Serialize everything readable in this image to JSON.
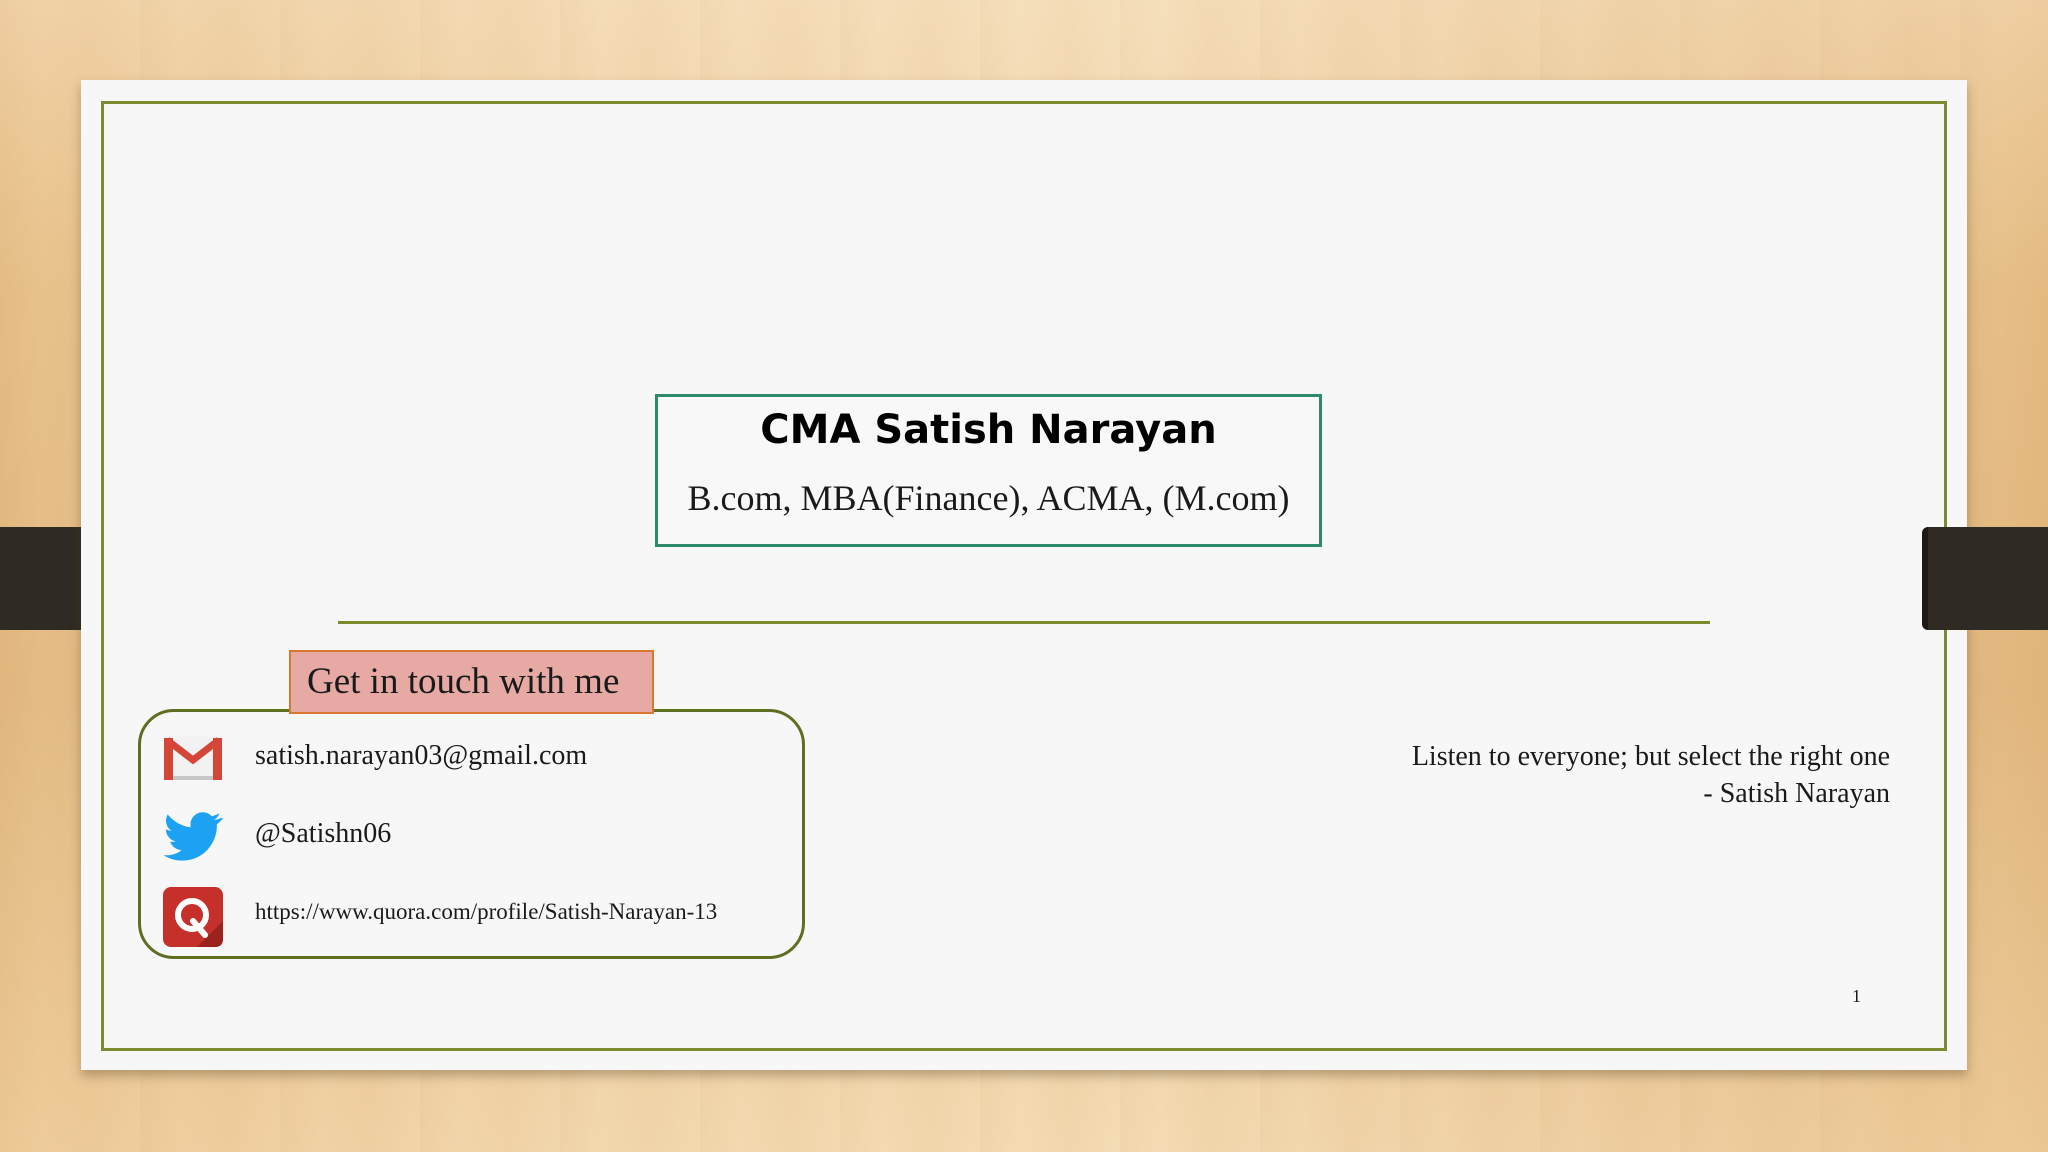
{
  "title": {
    "name": "CMA Satish Narayan",
    "qualifications": "B.com, MBA(Finance), ACMA, (M.com)"
  },
  "contact": {
    "heading": "Get in touch with me",
    "items": [
      {
        "icon": "gmail-icon",
        "text": "satish.narayan03@gmail.com"
      },
      {
        "icon": "twitter-icon",
        "text": "@Satishn06"
      },
      {
        "icon": "quora-icon",
        "text": "https://www.quora.com/profile/Satish-Narayan-13"
      }
    ]
  },
  "quote": {
    "line": "Listen to everyone; but select the right one",
    "author": "- Satish Narayan"
  },
  "page_number": "1",
  "colors": {
    "frame_border": "#7a8c2e",
    "title_border": "#2d8a6a",
    "label_fill": "#e7a9a3",
    "label_border": "#d9772e"
  }
}
